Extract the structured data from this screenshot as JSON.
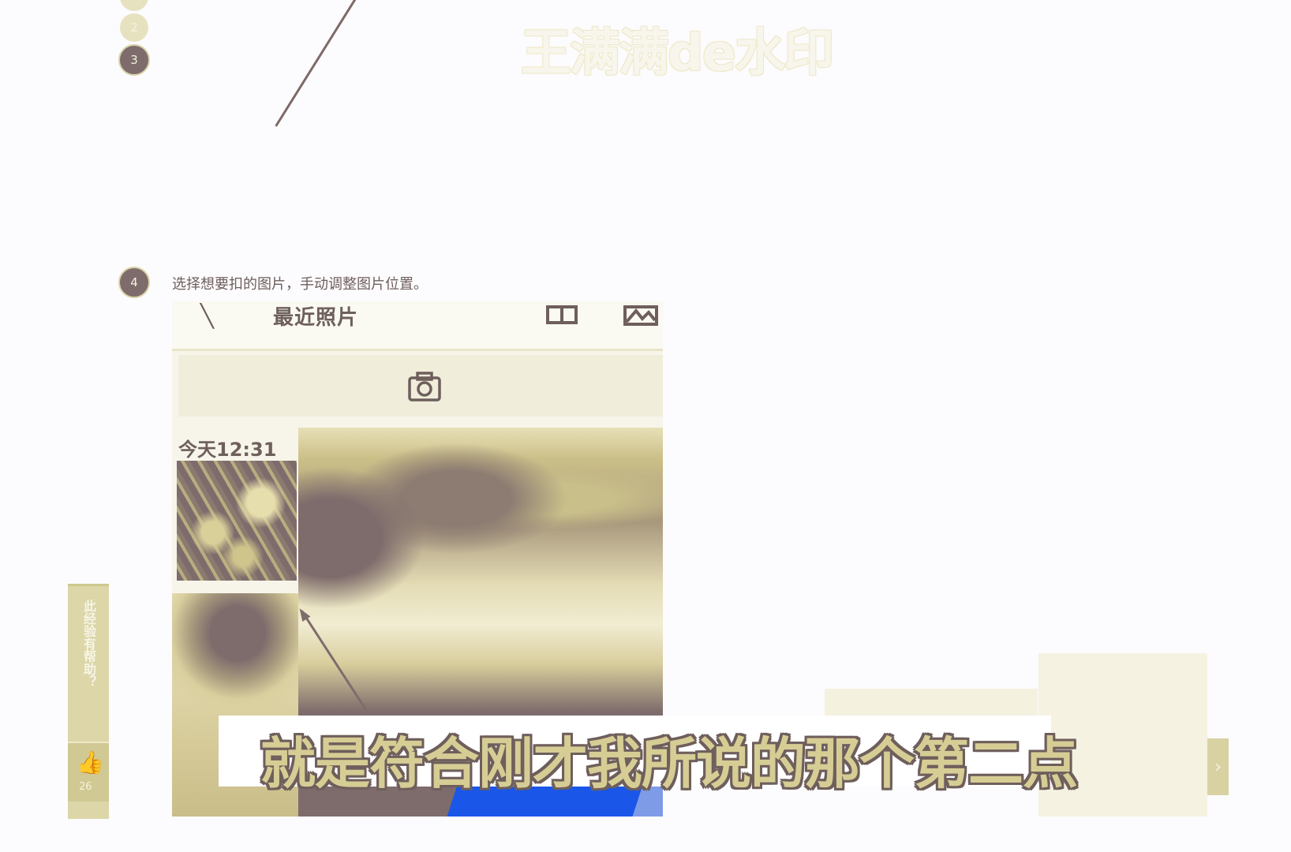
{
  "watermark": "王满满de水印",
  "steps": {
    "step2": "2",
    "step3": "3",
    "step4": "4",
    "step4_text": "选择想要扣的图片，手动调整图片位置。"
  },
  "phone": {
    "back_icon": "back-arrow-icon",
    "title": "最近照片",
    "icons": [
      "grid-view-icon",
      "gallery-icon",
      "camera-icon"
    ],
    "date_label": "今天12:31"
  },
  "feedback": {
    "text": "此经验有帮助？",
    "like_icon": "thumbs-up-icon",
    "like_count": "26"
  },
  "subtitle": "就是符合刚才我所说的那个第二点",
  "colors": {
    "background": "#fcfbfd",
    "ink": "#7e6c6c",
    "accent": "#dcd6a8",
    "blue": "#1a56e8"
  }
}
